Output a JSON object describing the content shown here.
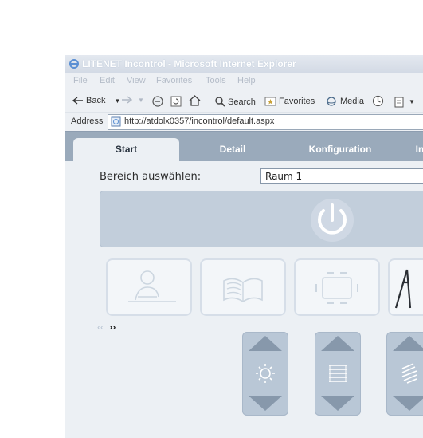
{
  "window": {
    "title": "LITENET Incontrol - Microsoft Internet Explorer"
  },
  "menu": [
    "File",
    "Edit",
    "View",
    "Favorites",
    "Tools",
    "Help"
  ],
  "toolbar": {
    "back": "Back",
    "search": "Search",
    "favorites": "Favorites",
    "media": "Media"
  },
  "address": {
    "label": "Address",
    "url": "http://atdolx0357/incontrol/default.aspx"
  },
  "tabs": [
    "Start",
    "Detail",
    "Konfiguration",
    "In"
  ],
  "area": {
    "label": "Bereich auswählen:",
    "selected": "Raum 1"
  },
  "scenes": [
    "desk-person-icon",
    "open-book-icon",
    "meeting-table-icon",
    "easel-icon"
  ],
  "pager": {
    "prev": "‹‹",
    "next": "››"
  },
  "controls": [
    "brightness-icon",
    "blinds-icon",
    "blinds-tilt-icon"
  ],
  "colors": {
    "tab_bar": "#9aaabb",
    "panel": "#c2cedb",
    "control": "#b9c7d6"
  }
}
